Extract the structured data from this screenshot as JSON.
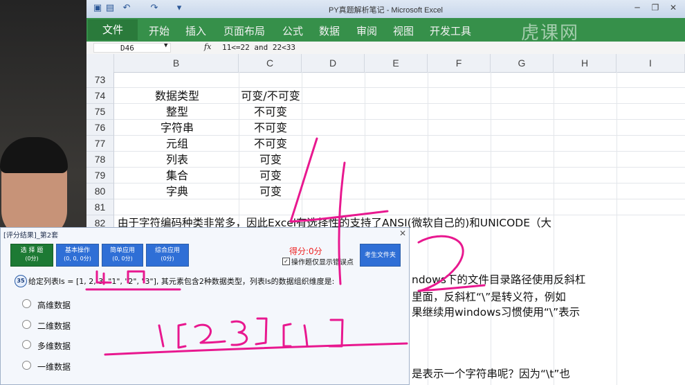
{
  "window": {
    "title": "PY真题解析笔记 - Microsoft Excel"
  },
  "ribbon": {
    "file_tab": "文件",
    "tabs": [
      "开始",
      "插入",
      "页面布局",
      "公式",
      "数据",
      "审阅",
      "视图",
      "开发工具"
    ],
    "watermark": "虎课网",
    "color": "#36904a"
  },
  "formula_bar": {
    "cell_ref": "D46",
    "fx": "fx",
    "formula": "11<=22 and 22<33"
  },
  "columns": [
    "B",
    "C",
    "D",
    "E",
    "F",
    "G",
    "H",
    "I"
  ],
  "rows": [
    "73",
    "74",
    "75",
    "76",
    "77",
    "78",
    "79",
    "80",
    "81",
    "82"
  ],
  "table": [
    {
      "type": "数据类型",
      "mutability": "可变/不可变"
    },
    {
      "type": "整型",
      "mutability": "不可变"
    },
    {
      "type": "字符串",
      "mutability": "不可变"
    },
    {
      "type": "元组",
      "mutability": "不可变"
    },
    {
      "type": "列表",
      "mutability": "可变"
    },
    {
      "type": "集合",
      "mutability": "可变"
    },
    {
      "type": "字典",
      "mutability": "可变"
    }
  ],
  "paragraph": {
    "line1": "由于字符编码种类非常多，因此Excel有选择性的支持了ANSI(微软自己的)和UNICODE（大",
    "line2a": "ndows下的文件目录路径使用反斜杠",
    "line2b": "里面，反斜杠“\\”是转义符，例如",
    "line2c": "果继续用windows习惯使用“\\”表示",
    "line3": "是表示一个字符串呢？因为“\\t”也"
  },
  "dialog": {
    "title": "[评分结果]_第2套",
    "close": "✕",
    "buttons": [
      {
        "label": "选 择 题",
        "score": "(0分)"
      },
      {
        "label": "基本操作",
        "score": "(0, 0, 0分)"
      },
      {
        "label": "简单应用",
        "score": "(0, 0分)"
      },
      {
        "label": "综合应用",
        "score": "(0分)"
      }
    ],
    "score": "得分:0分",
    "checkbox_label": "操作题仅显示错误点",
    "folder_button": "考生文件夹",
    "question_number": "35",
    "question": "给定列表ls = [1, 2, 3, \"1\", \"2\", \"3\"], 其元素包含2种数据类型，列表ls的数据组织维度是:",
    "options": [
      "高维数据",
      "二维数据",
      "多维数据",
      "一维数据"
    ]
  },
  "annotation_color": "#e8188f"
}
